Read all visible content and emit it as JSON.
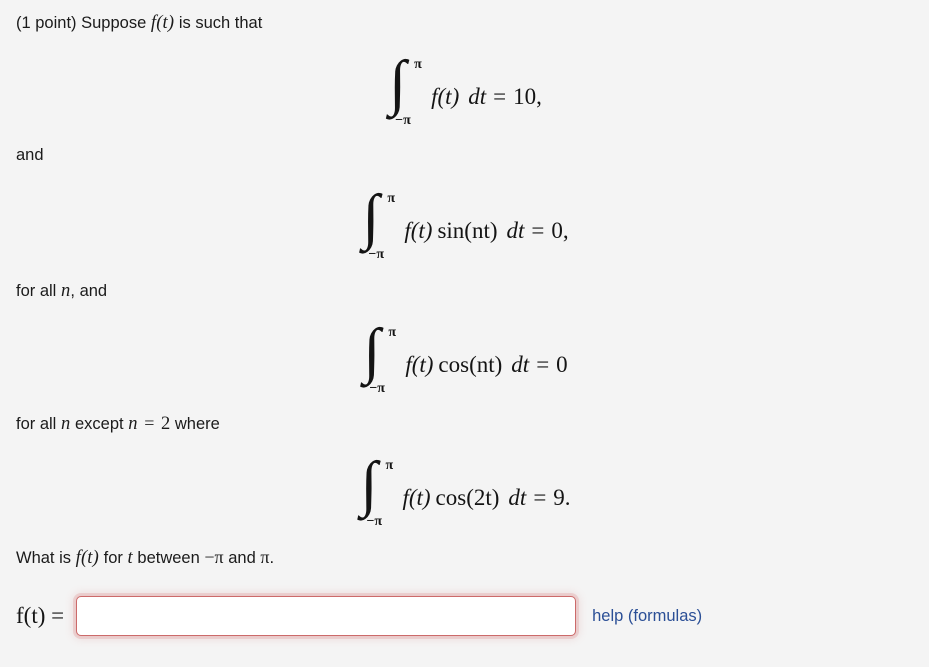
{
  "problem": {
    "points_label": "(1 point)",
    "intro_text_before": "Suppose",
    "intro_math": "f(t)",
    "intro_text_after": "is such that",
    "connector_and": "and",
    "condition_for_all_n_pre": "for all",
    "condition_for_all_n_var": "n",
    "condition_for_all_n_post": ", and",
    "exception_pre": "for all",
    "exception_var1": "n",
    "exception_mid": "except",
    "exception_var2": "n",
    "exception_eq": "=",
    "exception_value": "2",
    "exception_post": "where",
    "question_pre": "What is",
    "question_fn": "f(t)",
    "question_mid": "for",
    "question_var": "t",
    "question_between": "between",
    "question_lower": "−π",
    "question_and": "and",
    "question_upper": "π",
    "question_period": "."
  },
  "equations": [
    {
      "id": "integral-f-dt",
      "lower_limit": "−π",
      "upper_limit": "π",
      "integrand_fn": "f(t)",
      "integrand_factor": "",
      "differential": "dt",
      "equals": "=",
      "value": "10",
      "trailing": ","
    },
    {
      "id": "integral-f-sin-nt-dt",
      "lower_limit": "−π",
      "upper_limit": "π",
      "integrand_fn": "f(t)",
      "integrand_factor": "sin(nt)",
      "differential": "dt",
      "equals": "=",
      "value": "0",
      "trailing": ","
    },
    {
      "id": "integral-f-cos-nt-dt",
      "lower_limit": "−π",
      "upper_limit": "π",
      "integrand_fn": "f(t)",
      "integrand_factor": "cos(nt)",
      "differential": "dt",
      "equals": "=",
      "value": "0",
      "trailing": ""
    },
    {
      "id": "integral-f-cos-2t-dt",
      "lower_limit": "−π",
      "upper_limit": "π",
      "integrand_fn": "f(t)",
      "integrand_factor": "cos(2t)",
      "differential": "dt",
      "equals": "=",
      "value": "9",
      "trailing": "."
    }
  ],
  "answer": {
    "label": "f(t) =",
    "value": "",
    "placeholder": "",
    "help_link_text": "help (formulas)"
  },
  "colors": {
    "background": "#f4f4f4",
    "text": "#1a1a1a",
    "link": "#2b4f96",
    "input_border": "#cc6a6a",
    "input_background": "#ffffff"
  },
  "symbols": {
    "integral": "∫",
    "pi": "π",
    "minus": "−"
  }
}
